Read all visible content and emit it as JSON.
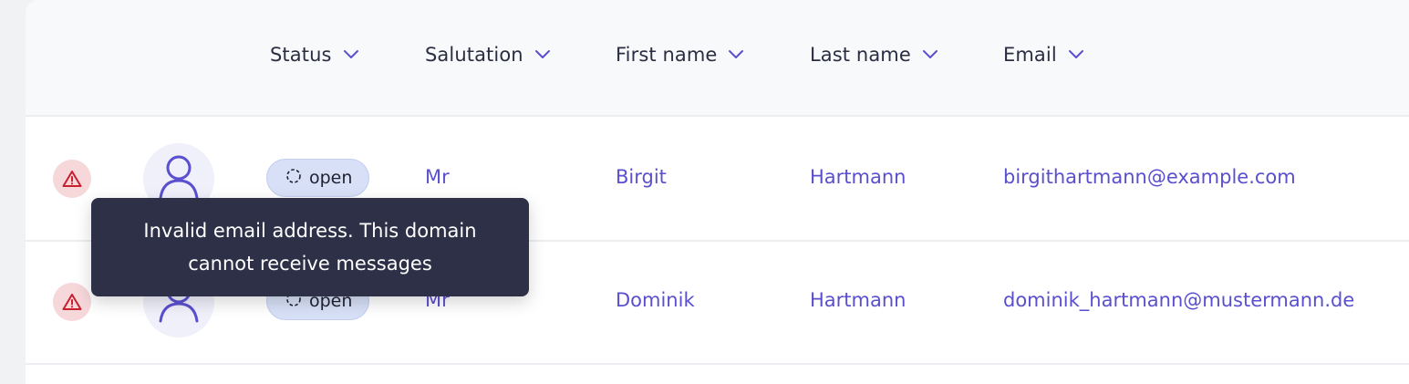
{
  "columns": [
    {
      "key": "status",
      "label": "Status"
    },
    {
      "key": "salutation",
      "label": "Salutation"
    },
    {
      "key": "first_name",
      "label": "First name"
    },
    {
      "key": "last_name",
      "label": "Last name"
    },
    {
      "key": "email",
      "label": "Email"
    }
  ],
  "rows": [
    {
      "status": "open",
      "salutation": "Mr",
      "first_name": "Birgit",
      "last_name": "Hartmann",
      "email": "birgithartmann@example.com"
    },
    {
      "status": "open",
      "salutation": "Mr",
      "first_name": "Dominik",
      "last_name": "Hartmann",
      "email": "dominik_hartmann@mustermann.de"
    }
  ],
  "tooltip": {
    "line1": "Invalid email address. This domain",
    "line2": "cannot receive messages"
  },
  "icons": {
    "warning": "warning-triangle-icon",
    "avatar": "user-icon",
    "status": "dashed-circle-icon",
    "sort": "chevron-down-icon"
  },
  "colors": {
    "accent": "#5a4fcf",
    "warning_bg": "#f6d7da",
    "warning_fg": "#c8202f",
    "status_bg": "#d7e0f7",
    "tooltip_bg": "#2d3047"
  }
}
